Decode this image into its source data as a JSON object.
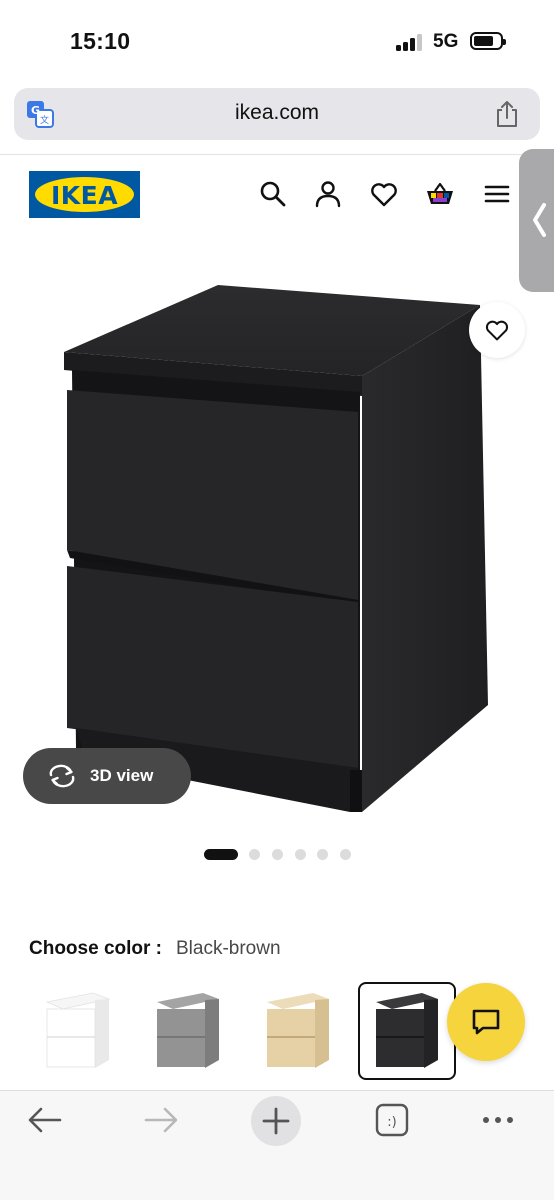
{
  "status_bar": {
    "time": "15:10",
    "network": "5G"
  },
  "browser": {
    "url": "ikea.com"
  },
  "header": {
    "logo_text": "IKEA",
    "icons": [
      "search-icon",
      "user-icon",
      "heart-icon",
      "basket-icon",
      "menu-icon"
    ]
  },
  "product": {
    "view3d_label": "3D view",
    "image_count": 6,
    "active_image_index": 0
  },
  "color_chooser": {
    "label": "Choose color :",
    "selected_value": "Black-brown",
    "options": [
      {
        "color": "#f4f4f4",
        "selected": false
      },
      {
        "color": "#8f8f8f",
        "selected": false
      },
      {
        "color": "#e3cfa6",
        "selected": false
      },
      {
        "color": "#2a2a2d",
        "selected": true
      }
    ]
  },
  "toolbar": {
    "icons": [
      "back-arrow-icon",
      "forward-arrow-icon",
      "new-tab-icon",
      "tabs-icon",
      "more-icon"
    ]
  },
  "colors": {
    "ikea_blue": "#0058a3",
    "ikea_yellow": "#ffdb00",
    "chat_yellow": "#f5d43d",
    "product_black": "#2a2a2d"
  }
}
